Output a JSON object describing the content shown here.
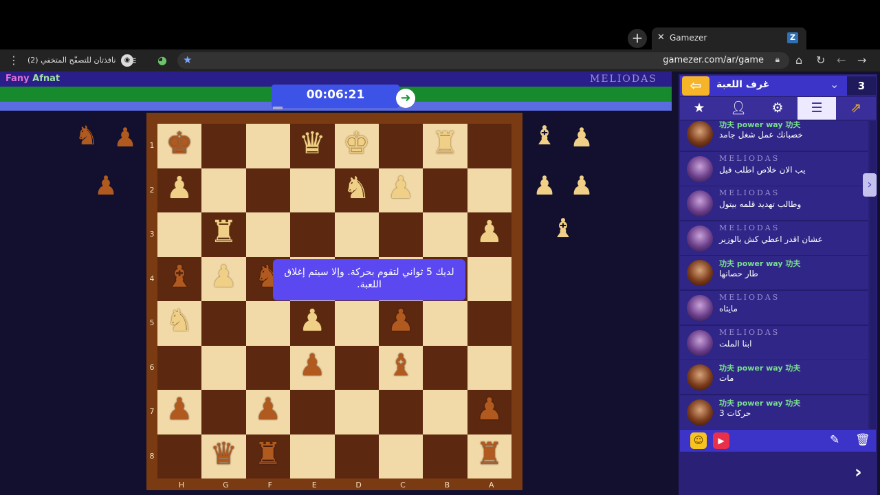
{
  "browser": {
    "tab_title": "Gamezer",
    "tab_close": "✕",
    "new_tab": "+",
    "favicon": "Z",
    "url": "gamezer.com/ar/game",
    "incognito_label": "نافذتان للتصفّح المتخفي (2)",
    "menu_icon": "⋮"
  },
  "game": {
    "player_left": "Fany",
    "player_left_b": "Afnat",
    "player_right": "MELIODAS",
    "timer": "00:06:21",
    "toast": "لديك 5 ثواني لتقوم بحركة. وإلا سيتم إغلاق اللعبة.",
    "ranks": [
      "1",
      "2",
      "3",
      "4",
      "5",
      "6",
      "7",
      "8"
    ],
    "files": [
      "H",
      "G",
      "F",
      "E",
      "D",
      "C",
      "B",
      "A"
    ]
  },
  "panel": {
    "title": "غرف اللعبة",
    "count": "3",
    "messages": [
      {
        "user": "power way",
        "type": "pw",
        "text": "خصبانك عمل شغل جامد"
      },
      {
        "user": "MELIODAS",
        "type": "me",
        "text": "يب الان خلاص اطلب فيل"
      },
      {
        "user": "MELIODAS",
        "type": "me",
        "text": "وطالب تهديد قلمه بيتول"
      },
      {
        "user": "MELIODAS",
        "type": "me",
        "text": "عشان اقدر اعطي كش بالوزير"
      },
      {
        "user": "power way",
        "type": "pw",
        "text": "طار حصانها"
      },
      {
        "user": "MELIODAS",
        "type": "me",
        "text": "مايثاه"
      },
      {
        "user": "MELIODAS",
        "type": "me",
        "text": "ابنا الملت"
      },
      {
        "user": "power way",
        "type": "pw",
        "text": "مات"
      },
      {
        "user": "power way",
        "type": "pw",
        "text": "حركات 3"
      }
    ]
  },
  "colors": {
    "accent": "#3d52e6",
    "panel": "#2a2076",
    "toast": "#5b48f0"
  }
}
